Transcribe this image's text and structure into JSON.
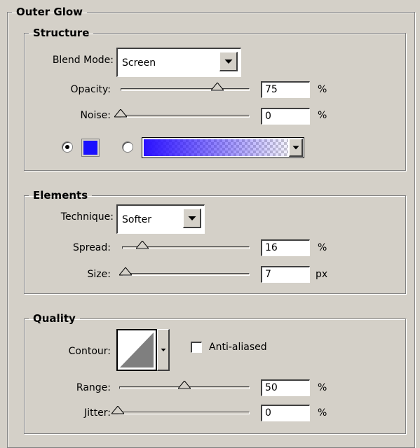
{
  "outer_glow": {
    "title": "Outer Glow"
  },
  "structure": {
    "title": "Structure",
    "blend_mode_label": "Blend Mode:",
    "blend_mode_value": "Screen",
    "opacity_label": "Opacity:",
    "opacity_value": "75",
    "opacity_unit": "%",
    "noise_label": "Noise:",
    "noise_value": "0",
    "noise_unit": "%",
    "color_selected": "solid",
    "solid_color": "#1a10ff",
    "gradient_color": "#2a10ff"
  },
  "elements": {
    "title": "Elements",
    "technique_label": "Technique:",
    "technique_value": "Softer",
    "spread_label": "Spread:",
    "spread_value": "16",
    "spread_unit": "%",
    "size_label": "Size:",
    "size_value": "7",
    "size_unit": "px"
  },
  "quality": {
    "title": "Quality",
    "contour_label": "Contour:",
    "anti_aliased_label": "Anti-aliased",
    "anti_aliased_checked": false,
    "range_label": "Range:",
    "range_value": "50",
    "range_unit": "%",
    "jitter_label": "Jitter:",
    "jitter_value": "0",
    "jitter_unit": "%"
  }
}
